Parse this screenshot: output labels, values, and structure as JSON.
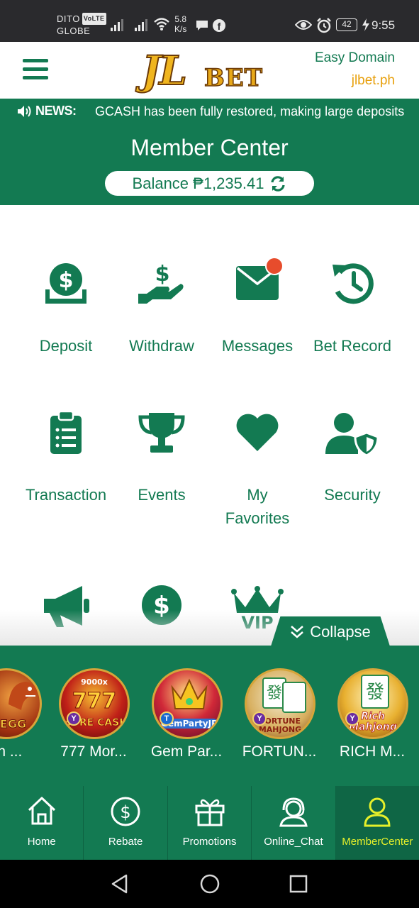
{
  "status_bar": {
    "carrier1": "DITO",
    "volte": "VoLTE",
    "carrier2": "GLOBE",
    "speed_value": "5.8",
    "speed_unit": "K/s",
    "battery": "42",
    "time": "9:55"
  },
  "header": {
    "logo_big": "JL",
    "logo_small": "BET",
    "easy_domain": "Easy Domain",
    "domain": "jlbet.ph"
  },
  "news": {
    "label": "NEWS:",
    "text": "GCASH has been fully restored, making large deposits"
  },
  "member": {
    "title": "Member Center",
    "balance": "Balance ₱1,235.41"
  },
  "grid": {
    "deposit": "Deposit",
    "withdraw": "Withdraw",
    "messages": "Messages",
    "bet_record": "Bet Record",
    "transaction": "Transaction",
    "events": "Events",
    "favorites_line1": "My",
    "favorites_line2": "Favorites",
    "security": "Security"
  },
  "collapse_label": "Collapse",
  "games": [
    {
      "name": "on ...",
      "art": "N EGG"
    },
    {
      "name": "777 Mor...",
      "art": "MORE CASH",
      "art_top": "9000x"
    },
    {
      "name": "Gem Par...",
      "art": "GemPartyJP"
    },
    {
      "name": "FORTUN...",
      "art": "FORTUNE MAHJONG"
    },
    {
      "name": "RICH M...",
      "art": "Rich Mahjong"
    }
  ],
  "bottom_nav": {
    "home": "Home",
    "rebate": "Rebate",
    "promotions": "Promotions",
    "online_chat": "Online_Chat",
    "member_center": "MemberCenter"
  },
  "colors": {
    "brand_green": "#137a52",
    "accent_gold": "#e8a00c",
    "active_nav": "#e6f02a",
    "badge_red": "#e74c2c"
  }
}
